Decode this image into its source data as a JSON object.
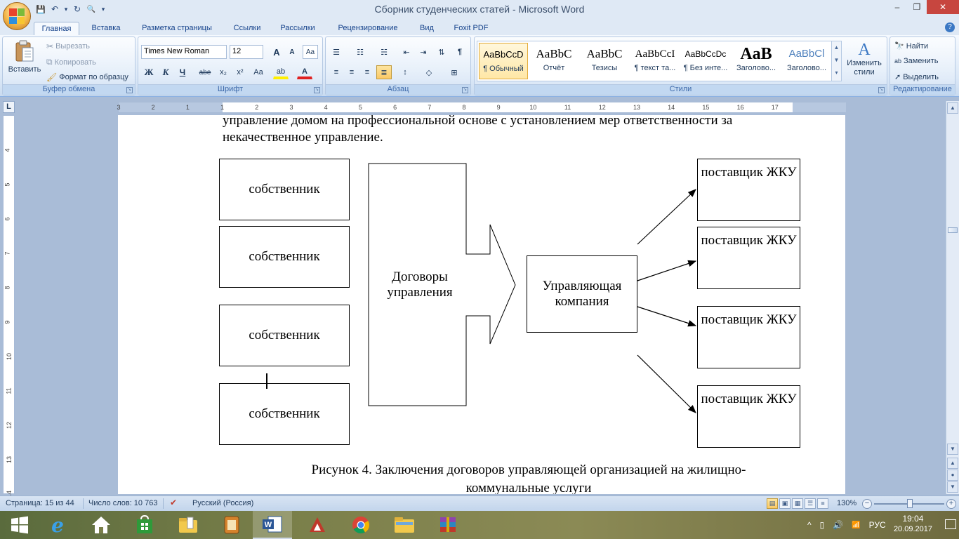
{
  "window": {
    "title": "Сборник студенческих статей - Microsoft Word",
    "minimize": "–",
    "maximize": "❐",
    "close": "✕"
  },
  "qat": {
    "save": "💾",
    "undo": "↶",
    "redo": "↻",
    "preview": "🔍",
    "more": "▾"
  },
  "tabs": [
    "Главная",
    "Вставка",
    "Разметка страницы",
    "Ссылки",
    "Рассылки",
    "Рецензирование",
    "Вид",
    "Foxit PDF"
  ],
  "help": "?",
  "ribbon": {
    "clipboard": {
      "label": "Буфер обмена",
      "paste": "Вставить",
      "cut": "Вырезать",
      "copy": "Копировать",
      "format_painter": "Формат по образцу"
    },
    "font": {
      "label": "Шрифт",
      "font_name": "Times New Roman",
      "font_size": "12",
      "grow": "A",
      "shrink": "A",
      "clear": "Aa",
      "bold": "Ж",
      "italic": "К",
      "underline": "Ч",
      "strike": "abe",
      "subscript": "x₂",
      "superscript": "x²",
      "case": "Aa",
      "highlight": "ab",
      "color": "A"
    },
    "paragraph": {
      "label": "Абзац",
      "pilcrow": "¶"
    },
    "styles": {
      "label": "Стили",
      "items": [
        {
          "sample": "AaBbCcD",
          "name": "¶ Обычный"
        },
        {
          "sample": "AaBbC",
          "name": "Отчёт"
        },
        {
          "sample": "AaBbC",
          "name": "Тезисы"
        },
        {
          "sample": "AaBbCcI",
          "name": "¶ текст та..."
        },
        {
          "sample": "AaBbCcDc",
          "name": "¶ Без инте..."
        },
        {
          "sample": "AaB",
          "name": "Заголово..."
        },
        {
          "sample": "AaBbCl",
          "name": "Заголово..."
        }
      ],
      "change_styles": "Изменить стили"
    },
    "editing": {
      "label": "Редактирование",
      "find": "Найти",
      "replace": "Заменить",
      "select": "Выделить"
    }
  },
  "ruler": {
    "corner": "L",
    "ticks": [
      "3",
      "2",
      "1",
      "1",
      "2",
      "3",
      "4",
      "5",
      "6",
      "7",
      "8",
      "9",
      "10",
      "11",
      "12",
      "13",
      "14",
      "15",
      "16",
      "17"
    ],
    "vticks": [
      "4",
      "5",
      "6",
      "7",
      "8",
      "9",
      "10",
      "11",
      "12",
      "13",
      "14"
    ]
  },
  "document": {
    "para_line1": "управление домом на профессиональной основе с установлением мер ответственности за",
    "para_line2": "некачественное управление.",
    "owner1": "собственник",
    "owner2": "собственник",
    "owner3": "собственник",
    "owner4": "собственник",
    "contracts": "Договоры управления",
    "company": "Управляющая компания",
    "supplier1": "поставщик ЖКУ",
    "supplier2": "поставщик ЖКУ",
    "supplier3": "поставщик ЖКУ",
    "supplier4": "поставщик ЖКУ",
    "caption_line1": "Рисунок 4. Заключения договоров управляющей организацией на жилищно-",
    "caption_line2": "коммунальные услуги"
  },
  "status": {
    "page": "Страница: 15 из 44",
    "words": "Число слов: 10 763",
    "language": "Русский (Россия)",
    "zoom": "130%"
  },
  "taskbar": {
    "language": "РУС",
    "time": "19:04",
    "date": "20.09.2017"
  }
}
